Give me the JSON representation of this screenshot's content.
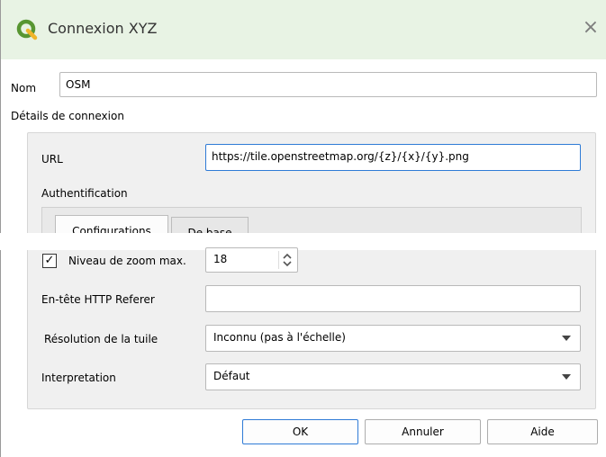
{
  "window": {
    "title": "Connexion XYZ"
  },
  "name_field": {
    "label": "Nom",
    "value": "OSM"
  },
  "connection": {
    "section_label": "Détails de connexion",
    "url_label": "URL",
    "url_value": "https://tile.openstreetmap.org/{z}/{x}/{y}.png",
    "auth_label": "Authentification",
    "tabs": [
      {
        "label": "Configurations",
        "active": true
      },
      {
        "label": "De base",
        "active": false
      }
    ],
    "zoom_max": {
      "label": "Niveau de zoom max.",
      "checked": true,
      "check_glyph": "✓",
      "value": "18"
    },
    "referer": {
      "label": "En-tête HTTP Referer",
      "value": ""
    },
    "tile_resolution": {
      "label": "Résolution de la tuile",
      "value": "Inconnu (pas à l'échelle)"
    },
    "interpretation": {
      "label": "Interpretation",
      "value": "Défaut"
    }
  },
  "buttons": {
    "ok": "OK",
    "cancel": "Annuler",
    "help": "Aide"
  },
  "icons": {
    "close": "×",
    "app": "qgis-logo-icon"
  },
  "colors": {
    "accent": "#2f7bd6",
    "titlebar": "#e8f3e4",
    "brand_green": "#589632",
    "brand_yellow": "#f0b52b"
  }
}
